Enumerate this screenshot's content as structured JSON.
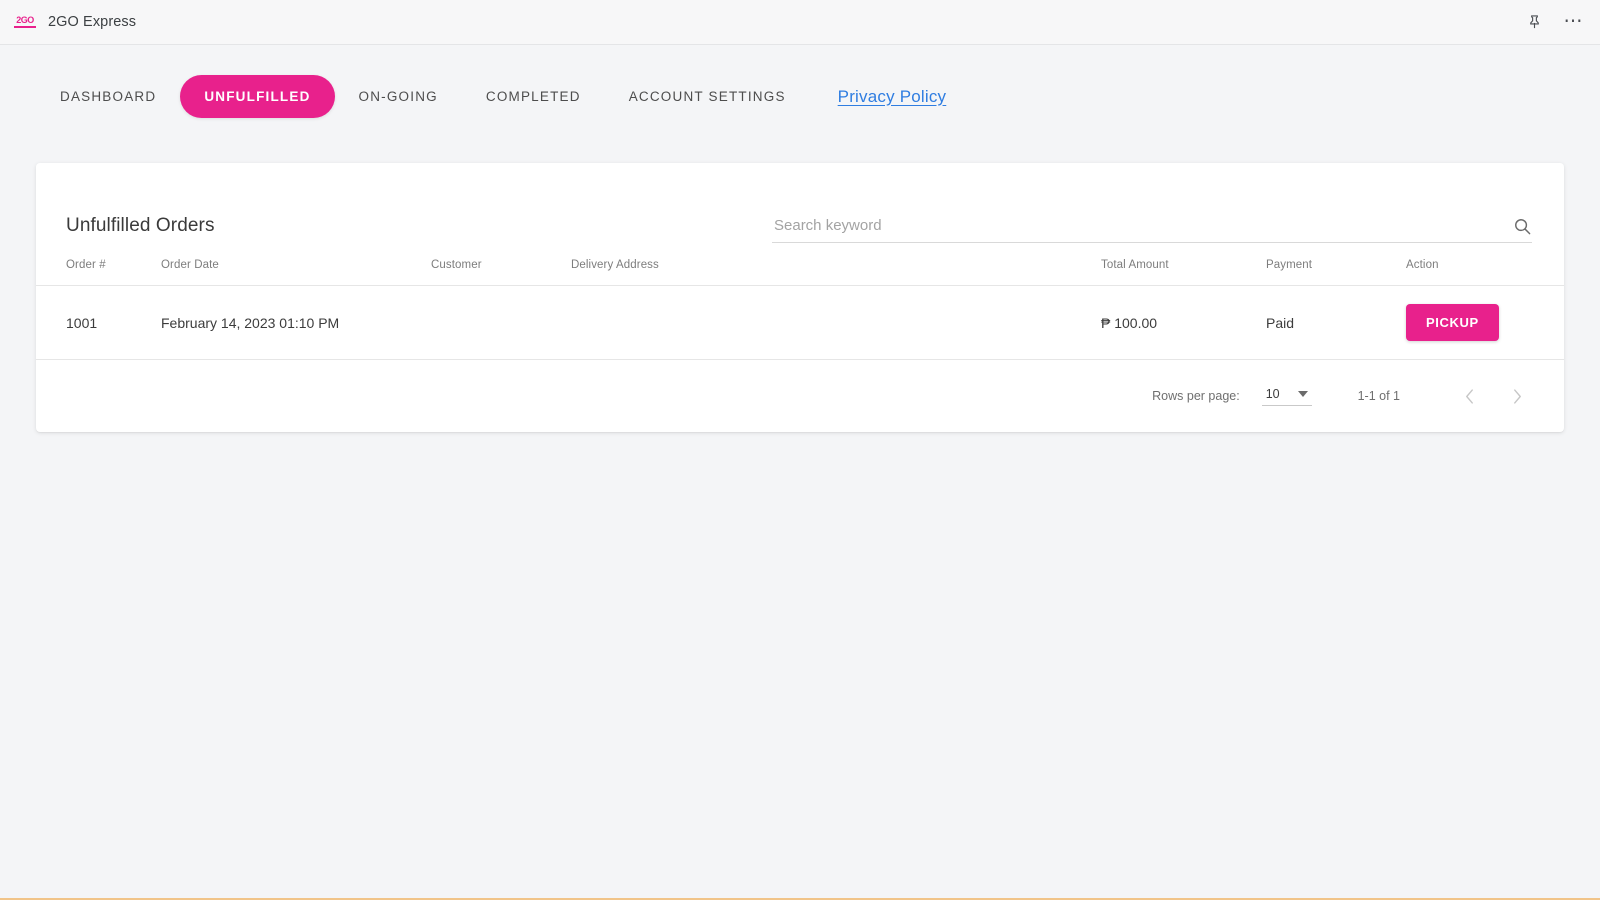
{
  "titlebar": {
    "logo_text": "2GO",
    "app_name": "2GO Express",
    "pin_icon": "pin-icon",
    "more_icon": "more-options-icon"
  },
  "tabs": [
    {
      "label": "DASHBOARD",
      "active": false
    },
    {
      "label": "UNFULFILLED",
      "active": true
    },
    {
      "label": "ON-GOING",
      "active": false
    },
    {
      "label": "COMPLETED",
      "active": false
    },
    {
      "label": "ACCOUNT SETTINGS",
      "active": false
    }
  ],
  "privacy_link": "Privacy Policy",
  "card": {
    "title": "Unfulfilled Orders",
    "search": {
      "placeholder": "Search keyword",
      "value": "",
      "icon": "search-icon"
    }
  },
  "table": {
    "columns": [
      "Order #",
      "Order Date",
      "Customer",
      "Delivery Address",
      "Total Amount",
      "Payment",
      "Action"
    ],
    "rows": [
      {
        "order_no": "1001",
        "order_date": "February 14, 2023 01:10 PM",
        "customer": "",
        "delivery_address": "",
        "total_amount": "₱ 100.00",
        "payment": "Paid",
        "action_label": "PICKUP"
      }
    ]
  },
  "pagination": {
    "rows_per_page_label": "Rows per page:",
    "rows_per_page_value": "10",
    "range_label": "1-1 of 1",
    "prev_icon": "chevron-left-icon",
    "next_icon": "chevron-right-icon"
  },
  "colors": {
    "accent_pink": "#e8218c",
    "link_blue": "#2f7de1",
    "page_bg": "#f4f5f7",
    "bottom_accent": "#f1c489"
  }
}
